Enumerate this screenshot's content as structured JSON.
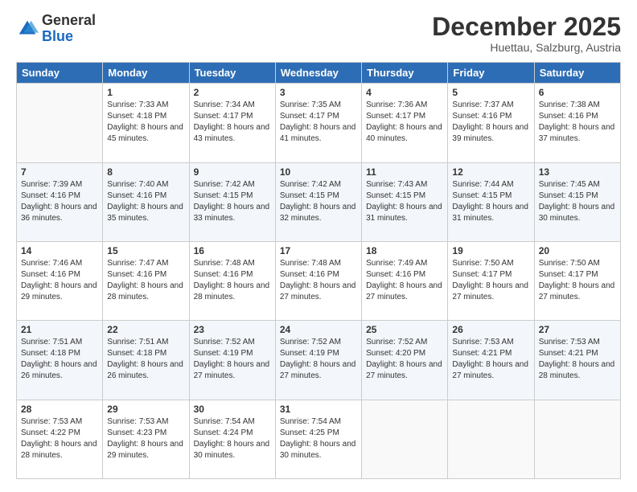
{
  "logo": {
    "line1": "General",
    "line2": "Blue"
  },
  "title": "December 2025",
  "subtitle": "Huettau, Salzburg, Austria",
  "weekdays": [
    "Sunday",
    "Monday",
    "Tuesday",
    "Wednesday",
    "Thursday",
    "Friday",
    "Saturday"
  ],
  "weeks": [
    [
      {
        "day": "",
        "sunrise": "",
        "sunset": "",
        "daylight": ""
      },
      {
        "day": "1",
        "sunrise": "Sunrise: 7:33 AM",
        "sunset": "Sunset: 4:18 PM",
        "daylight": "Daylight: 8 hours and 45 minutes."
      },
      {
        "day": "2",
        "sunrise": "Sunrise: 7:34 AM",
        "sunset": "Sunset: 4:17 PM",
        "daylight": "Daylight: 8 hours and 43 minutes."
      },
      {
        "day": "3",
        "sunrise": "Sunrise: 7:35 AM",
        "sunset": "Sunset: 4:17 PM",
        "daylight": "Daylight: 8 hours and 41 minutes."
      },
      {
        "day": "4",
        "sunrise": "Sunrise: 7:36 AM",
        "sunset": "Sunset: 4:17 PM",
        "daylight": "Daylight: 8 hours and 40 minutes."
      },
      {
        "day": "5",
        "sunrise": "Sunrise: 7:37 AM",
        "sunset": "Sunset: 4:16 PM",
        "daylight": "Daylight: 8 hours and 39 minutes."
      },
      {
        "day": "6",
        "sunrise": "Sunrise: 7:38 AM",
        "sunset": "Sunset: 4:16 PM",
        "daylight": "Daylight: 8 hours and 37 minutes."
      }
    ],
    [
      {
        "day": "7",
        "sunrise": "Sunrise: 7:39 AM",
        "sunset": "Sunset: 4:16 PM",
        "daylight": "Daylight: 8 hours and 36 minutes."
      },
      {
        "day": "8",
        "sunrise": "Sunrise: 7:40 AM",
        "sunset": "Sunset: 4:16 PM",
        "daylight": "Daylight: 8 hours and 35 minutes."
      },
      {
        "day": "9",
        "sunrise": "Sunrise: 7:42 AM",
        "sunset": "Sunset: 4:15 PM",
        "daylight": "Daylight: 8 hours and 33 minutes."
      },
      {
        "day": "10",
        "sunrise": "Sunrise: 7:42 AM",
        "sunset": "Sunset: 4:15 PM",
        "daylight": "Daylight: 8 hours and 32 minutes."
      },
      {
        "day": "11",
        "sunrise": "Sunrise: 7:43 AM",
        "sunset": "Sunset: 4:15 PM",
        "daylight": "Daylight: 8 hours and 31 minutes."
      },
      {
        "day": "12",
        "sunrise": "Sunrise: 7:44 AM",
        "sunset": "Sunset: 4:15 PM",
        "daylight": "Daylight: 8 hours and 31 minutes."
      },
      {
        "day": "13",
        "sunrise": "Sunrise: 7:45 AM",
        "sunset": "Sunset: 4:15 PM",
        "daylight": "Daylight: 8 hours and 30 minutes."
      }
    ],
    [
      {
        "day": "14",
        "sunrise": "Sunrise: 7:46 AM",
        "sunset": "Sunset: 4:16 PM",
        "daylight": "Daylight: 8 hours and 29 minutes."
      },
      {
        "day": "15",
        "sunrise": "Sunrise: 7:47 AM",
        "sunset": "Sunset: 4:16 PM",
        "daylight": "Daylight: 8 hours and 28 minutes."
      },
      {
        "day": "16",
        "sunrise": "Sunrise: 7:48 AM",
        "sunset": "Sunset: 4:16 PM",
        "daylight": "Daylight: 8 hours and 28 minutes."
      },
      {
        "day": "17",
        "sunrise": "Sunrise: 7:48 AM",
        "sunset": "Sunset: 4:16 PM",
        "daylight": "Daylight: 8 hours and 27 minutes."
      },
      {
        "day": "18",
        "sunrise": "Sunrise: 7:49 AM",
        "sunset": "Sunset: 4:16 PM",
        "daylight": "Daylight: 8 hours and 27 minutes."
      },
      {
        "day": "19",
        "sunrise": "Sunrise: 7:50 AM",
        "sunset": "Sunset: 4:17 PM",
        "daylight": "Daylight: 8 hours and 27 minutes."
      },
      {
        "day": "20",
        "sunrise": "Sunrise: 7:50 AM",
        "sunset": "Sunset: 4:17 PM",
        "daylight": "Daylight: 8 hours and 27 minutes."
      }
    ],
    [
      {
        "day": "21",
        "sunrise": "Sunrise: 7:51 AM",
        "sunset": "Sunset: 4:18 PM",
        "daylight": "Daylight: 8 hours and 26 minutes."
      },
      {
        "day": "22",
        "sunrise": "Sunrise: 7:51 AM",
        "sunset": "Sunset: 4:18 PM",
        "daylight": "Daylight: 8 hours and 26 minutes."
      },
      {
        "day": "23",
        "sunrise": "Sunrise: 7:52 AM",
        "sunset": "Sunset: 4:19 PM",
        "daylight": "Daylight: 8 hours and 27 minutes."
      },
      {
        "day": "24",
        "sunrise": "Sunrise: 7:52 AM",
        "sunset": "Sunset: 4:19 PM",
        "daylight": "Daylight: 8 hours and 27 minutes."
      },
      {
        "day": "25",
        "sunrise": "Sunrise: 7:52 AM",
        "sunset": "Sunset: 4:20 PM",
        "daylight": "Daylight: 8 hours and 27 minutes."
      },
      {
        "day": "26",
        "sunrise": "Sunrise: 7:53 AM",
        "sunset": "Sunset: 4:21 PM",
        "daylight": "Daylight: 8 hours and 27 minutes."
      },
      {
        "day": "27",
        "sunrise": "Sunrise: 7:53 AM",
        "sunset": "Sunset: 4:21 PM",
        "daylight": "Daylight: 8 hours and 28 minutes."
      }
    ],
    [
      {
        "day": "28",
        "sunrise": "Sunrise: 7:53 AM",
        "sunset": "Sunset: 4:22 PM",
        "daylight": "Daylight: 8 hours and 28 minutes."
      },
      {
        "day": "29",
        "sunrise": "Sunrise: 7:53 AM",
        "sunset": "Sunset: 4:23 PM",
        "daylight": "Daylight: 8 hours and 29 minutes."
      },
      {
        "day": "30",
        "sunrise": "Sunrise: 7:54 AM",
        "sunset": "Sunset: 4:24 PM",
        "daylight": "Daylight: 8 hours and 30 minutes."
      },
      {
        "day": "31",
        "sunrise": "Sunrise: 7:54 AM",
        "sunset": "Sunset: 4:25 PM",
        "daylight": "Daylight: 8 hours and 30 minutes."
      },
      {
        "day": "",
        "sunrise": "",
        "sunset": "",
        "daylight": ""
      },
      {
        "day": "",
        "sunrise": "",
        "sunset": "",
        "daylight": ""
      },
      {
        "day": "",
        "sunrise": "",
        "sunset": "",
        "daylight": ""
      }
    ]
  ]
}
